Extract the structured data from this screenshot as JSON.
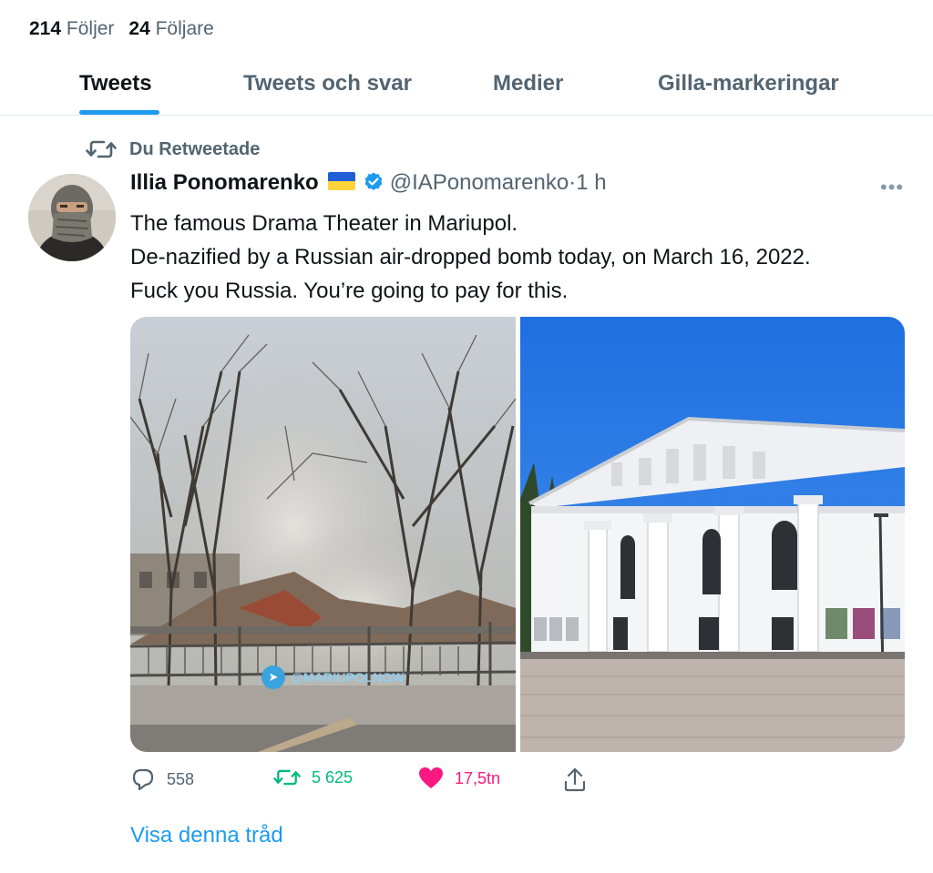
{
  "profile_stats": {
    "following_count": "214",
    "following_label": "Följer",
    "followers_count": "24",
    "followers_label": "Följare"
  },
  "tabs": [
    {
      "label": "Tweets",
      "active": true
    },
    {
      "label": "Tweets och svar",
      "active": false
    },
    {
      "label": "Medier",
      "active": false
    },
    {
      "label": "Gilla-markeringar",
      "active": false
    }
  ],
  "tweet": {
    "retweet_context": "Du Retweetade",
    "author_name": "Illia Ponomarenko",
    "author_flag_icon": "ukraine-flag-icon",
    "verified_icon": "verified-badge-icon",
    "handle": "@IAPonomarenko",
    "separator": "·",
    "time": "1 h",
    "text_lines": [
      "The famous Drama Theater in Mariupol.",
      "De-nazified by a Russian air-dropped bomb today, on March 16, 2022.",
      "Fuck you Russia. You’re going to pay for this."
    ],
    "media": {
      "left_watermark": "@MARIUPOLNOW",
      "left_watermark_icon": "telegram-icon"
    },
    "actions": {
      "reply_count": "558",
      "retweet_count": "5 625",
      "like_count": "17,5tn",
      "retweeted_color": "#00ba7c",
      "liked_color": "#f91880"
    },
    "show_thread_label": "Visa denna tråd"
  }
}
